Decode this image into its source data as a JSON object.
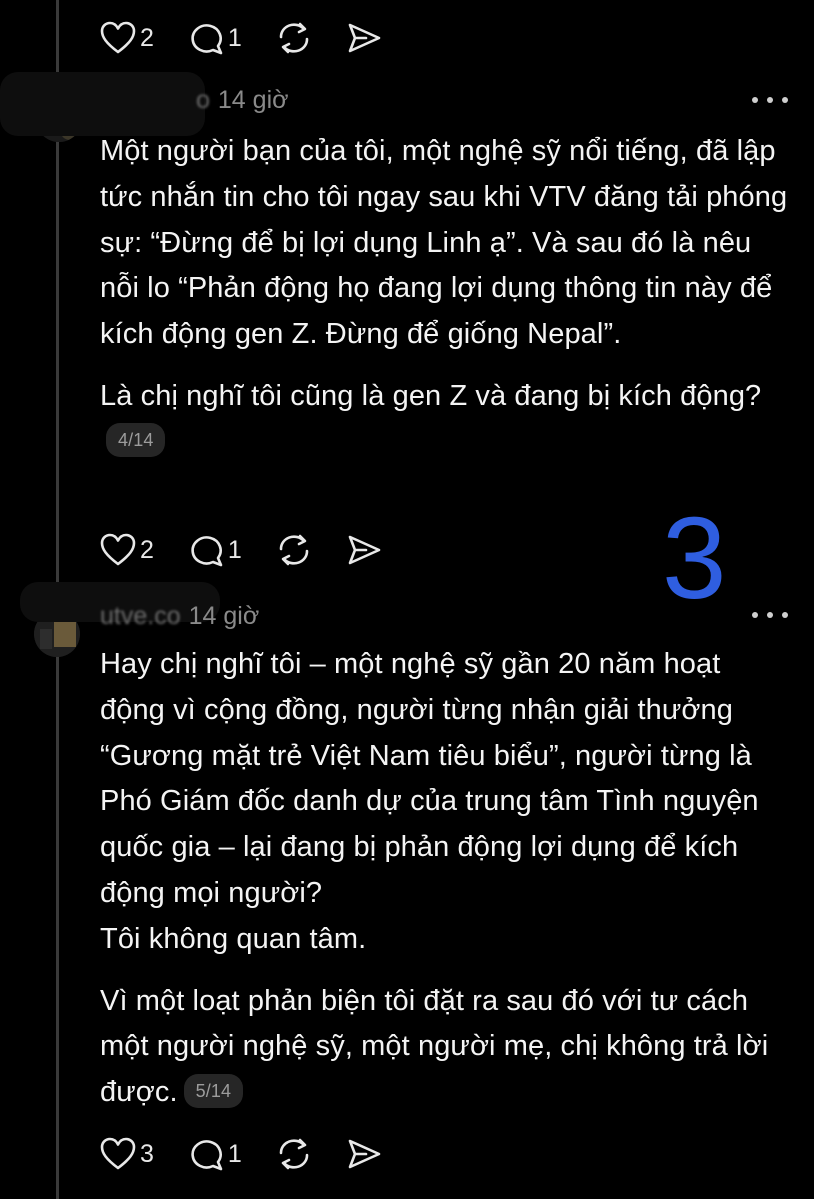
{
  "posts": [
    {
      "likes": "2",
      "replies": "1",
      "time": "14 giờ"
    },
    {
      "username": "o",
      "time": "14 giờ",
      "paragraphs": [
        "Một người bạn của tôi, một nghệ sỹ nổi tiếng, đã lập tức nhắn tin cho tôi ngay sau khi VTV đăng tải phóng sự: “Đừng để bị lợi dụng Linh ạ”. Và sau đó là nêu nỗi lo “Phản động họ đang lợi dụng thông tin này để kích động gen Z. Đừng để giống Nepal”.",
        "Là chị nghĩ tôi cũng là gen Z và đang bị kích động?"
      ],
      "page_tag": "4/14",
      "likes": "2",
      "replies": "1"
    },
    {
      "username": "utve.co",
      "time": "14 giờ",
      "paragraphs": [
        "Hay chị nghĩ tôi – một nghệ sỹ gần 20 năm hoạt động vì cộng đồng, người từng nhận giải thưởng “Gương mặt trẻ Việt Nam tiêu biểu”, người từng là Phó Giám đốc danh dự của trung tâm Tình nguyện quốc gia – lại đang bị phản động lợi dụng để kích động mọi người?\nTôi không quan tâm.",
        "Vì một loạt phản biện tôi đặt ra sau đó với tư cách một người nghệ sỹ, một người mẹ, chị không trả lời được."
      ],
      "page_tag": "5/14",
      "likes": "3",
      "replies": "1"
    }
  ],
  "annotation": "3",
  "icons": [
    "heart-icon",
    "comment-icon",
    "repost-icon",
    "share-icon",
    "more-icon"
  ],
  "colors": {
    "background": "#000000",
    "text": "#f4f4f4",
    "muted": "#8a8a8a",
    "annotation": "#2f5ee0"
  }
}
